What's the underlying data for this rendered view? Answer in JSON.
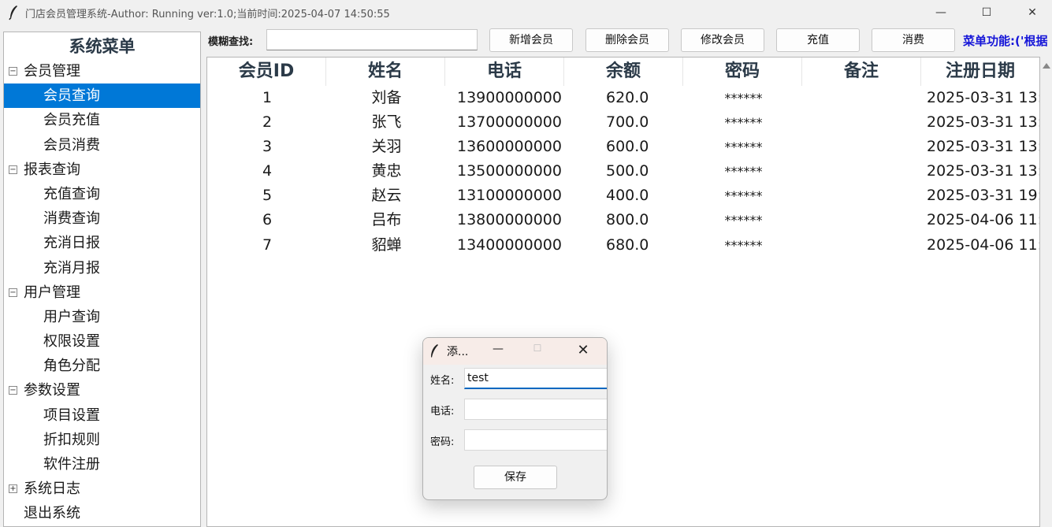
{
  "window": {
    "title": "门店会员管理系统-Author: Running  ver:1.0;当前时间:2025-04-07 14:50:55",
    "min_symbol": "—",
    "max_symbol": "☐",
    "close_symbol": "✕"
  },
  "sidebar": {
    "title": "系统菜单",
    "items": [
      {
        "label": "会员管理",
        "level": "parent",
        "expander": "⊟"
      },
      {
        "label": "会员查询",
        "level": "child",
        "selected": true
      },
      {
        "label": "会员充值",
        "level": "child"
      },
      {
        "label": "会员消费",
        "level": "child"
      },
      {
        "label": "报表查询",
        "level": "parent",
        "expander": "⊟"
      },
      {
        "label": "充值查询",
        "level": "child"
      },
      {
        "label": "消费查询",
        "level": "child"
      },
      {
        "label": "充消日报",
        "level": "child"
      },
      {
        "label": "充消月报",
        "level": "child"
      },
      {
        "label": "用户管理",
        "level": "parent",
        "expander": "⊟"
      },
      {
        "label": "用户查询",
        "level": "child"
      },
      {
        "label": "权限设置",
        "level": "child"
      },
      {
        "label": "角色分配",
        "level": "child"
      },
      {
        "label": "参数设置",
        "level": "parent",
        "expander": "⊟"
      },
      {
        "label": "项目设置",
        "level": "child"
      },
      {
        "label": "折扣规则",
        "level": "child"
      },
      {
        "label": "软件注册",
        "level": "child"
      },
      {
        "label": "系统日志",
        "level": "parent",
        "expander": "⊞"
      },
      {
        "label": "退出系统",
        "level": "parent"
      }
    ]
  },
  "toolbar": {
    "search_label": "模糊查找:",
    "search_value": "",
    "add_label": "新增会员",
    "delete_label": "删除会员",
    "edit_label": "修改会员",
    "recharge_label": "充值",
    "consume_label": "消费",
    "menu_func_text": "菜单功能:('根据"
  },
  "table": {
    "headers": [
      "会员ID",
      "姓名",
      "电话",
      "余额",
      "密码",
      "备注",
      "注册日期"
    ],
    "rows": [
      [
        "1",
        "刘备",
        "13900000000",
        "620.0",
        "******",
        "",
        "2025-03-31 13:"
      ],
      [
        "2",
        "张飞",
        "13700000000",
        "700.0",
        "******",
        "",
        "2025-03-31 13:"
      ],
      [
        "3",
        "关羽",
        "13600000000",
        "600.0",
        "******",
        "",
        "2025-03-31 13:"
      ],
      [
        "4",
        "黄忠",
        "13500000000",
        "500.0",
        "******",
        "",
        "2025-03-31 13:"
      ],
      [
        "5",
        "赵云",
        "13100000000",
        "400.0",
        "******",
        "",
        "2025-03-31 19:"
      ],
      [
        "6",
        "吕布",
        "13800000000",
        "800.0",
        "******",
        "",
        "2025-04-06 11:"
      ],
      [
        "7",
        "貂蝉",
        "13400000000",
        "680.0",
        "******",
        "",
        "2025-04-06 11:"
      ]
    ]
  },
  "dialog": {
    "title": "添...",
    "name_label": "姓名:",
    "name_value": "test",
    "phone_label": "电话:",
    "phone_value": "",
    "password_label": "密码:",
    "password_value": "",
    "save_label": "保存"
  },
  "colors": {
    "selected_bg": "#0078d7",
    "menu_func_text": "#1515d8",
    "header_text": "#2b3a48"
  }
}
